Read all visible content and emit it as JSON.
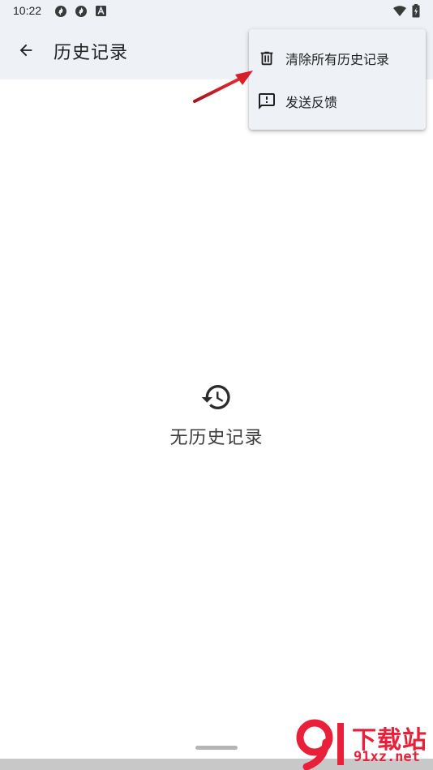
{
  "status_bar": {
    "time": "10:22",
    "left_icons": [
      "sync-icon",
      "sync-icon",
      "font-a-icon"
    ],
    "right_icons": [
      "wifi-icon",
      "battery-icon"
    ]
  },
  "app_bar": {
    "back_icon": "arrow-left-icon",
    "title": "历史记录"
  },
  "menu": {
    "items": [
      {
        "icon": "trash-icon",
        "label": "清除所有历史记录"
      },
      {
        "icon": "feedback-icon",
        "label": "发送反馈"
      }
    ]
  },
  "empty_state": {
    "icon": "history-icon",
    "text": "无历史记录"
  },
  "watermark": {
    "top_text": "下载站",
    "bottom_text": "91xz.net"
  },
  "colors": {
    "bar_background": "#eef1f6",
    "page_background": "#ffffff",
    "text_primary": "#1f1f1f",
    "annotation_arrow": "#d61f26",
    "watermark": "#e8203a"
  }
}
